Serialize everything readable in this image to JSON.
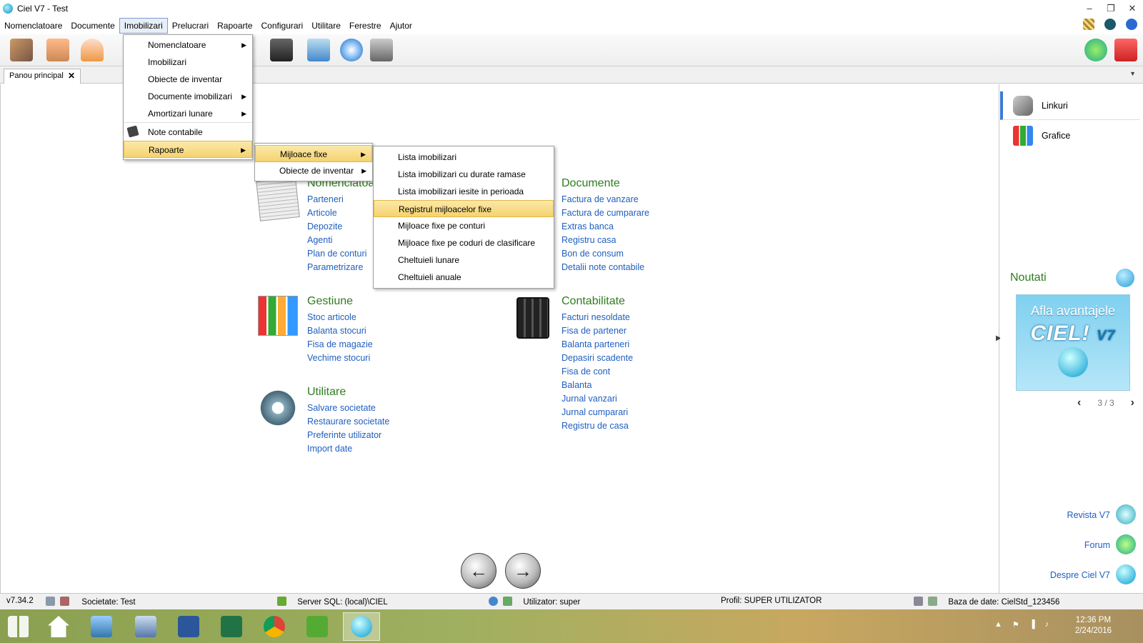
{
  "window": {
    "title": "Ciel V7 - Test"
  },
  "menubar": {
    "items": [
      "Nomenclatoare",
      "Documente",
      "Imobilizari",
      "Prelucrari",
      "Rapoarte",
      "Configurari",
      "Utilitare",
      "Ferestre",
      "Ajutor"
    ],
    "active": "Imobilizari"
  },
  "tabs": [
    {
      "label": "Panou principal"
    }
  ],
  "imobilizari_menu": {
    "items": [
      "Nomenclatoare",
      "Imobilizari",
      "Obiecte de inventar",
      "Documente imobilizari",
      "Amortizari lunare",
      "Note contabile",
      "Rapoarte"
    ]
  },
  "rapoarte_submenu": {
    "items": [
      "Mijloace fixe",
      "Obiecte de inventar"
    ]
  },
  "mijloace_submenu": {
    "items": [
      "Lista imobilizari",
      "Lista imobilizari cu durate ramase",
      "Lista imobilizari iesite in perioada",
      "Registrul mijloacelor fixe",
      "Mijloace fixe pe conturi",
      "Mijloace fixe pe coduri de clasificare",
      "Cheltuieli lunare",
      "Cheltuieli anuale"
    ]
  },
  "dashboard": {
    "nomenclatoare": {
      "title": "Nomenclatoa",
      "links": [
        "Parteneri",
        "Articole",
        "Depozite",
        "Agenti",
        "Plan de conturi",
        "Parametrizare"
      ]
    },
    "documente": {
      "title": "Documente",
      "links": [
        "Factura de vanzare",
        "Factura de cumparare",
        "Extras banca",
        "Registru casa",
        "Bon de consum",
        "Detalii note contabile"
      ]
    },
    "gestiune": {
      "title": "Gestiune",
      "links": [
        "Stoc articole",
        "Balanta stocuri",
        "Fisa de magazie",
        "Vechime stocuri"
      ]
    },
    "contabilitate": {
      "title": "Contabilitate",
      "links": [
        "Facturi nesoldate",
        "Fisa de partener",
        "Balanta parteneri",
        "Depasiri scadente",
        "Fisa de cont",
        "Balanta",
        "Jurnal vanzari",
        "Jurnal cumparari",
        "Registru de casa"
      ]
    },
    "utilitare": {
      "title": "Utilitare",
      "links": [
        "Salvare societate",
        "Restaurare societate",
        "Preferinte utilizator",
        "Import date"
      ]
    }
  },
  "right_panel": {
    "items": [
      "Linkuri",
      "Grafice"
    ],
    "news_title": "Noutati",
    "banner": {
      "line1": "Afla avantajele",
      "line2": "CIEL!",
      "line3": "V7"
    },
    "pager": "3 / 3",
    "links": [
      "Revista V7",
      "Forum",
      "Despre Ciel V7"
    ]
  },
  "statusbar": {
    "version": "v7.34.2",
    "societate": "Societate: Test",
    "server": "Server SQL: (local)\\CIEL",
    "utilizator": "Utilizator: super",
    "profil": "Profil: SUPER UTILIZATOR",
    "baza": "Baza de date: CielStd_123456"
  },
  "taskbar": {
    "time": "12:36 PM",
    "date": "2/24/2016"
  },
  "colors": {
    "accent_green": "#2e7d1e",
    "link_blue": "#1f5fbf",
    "highlight": "#f5d270"
  }
}
